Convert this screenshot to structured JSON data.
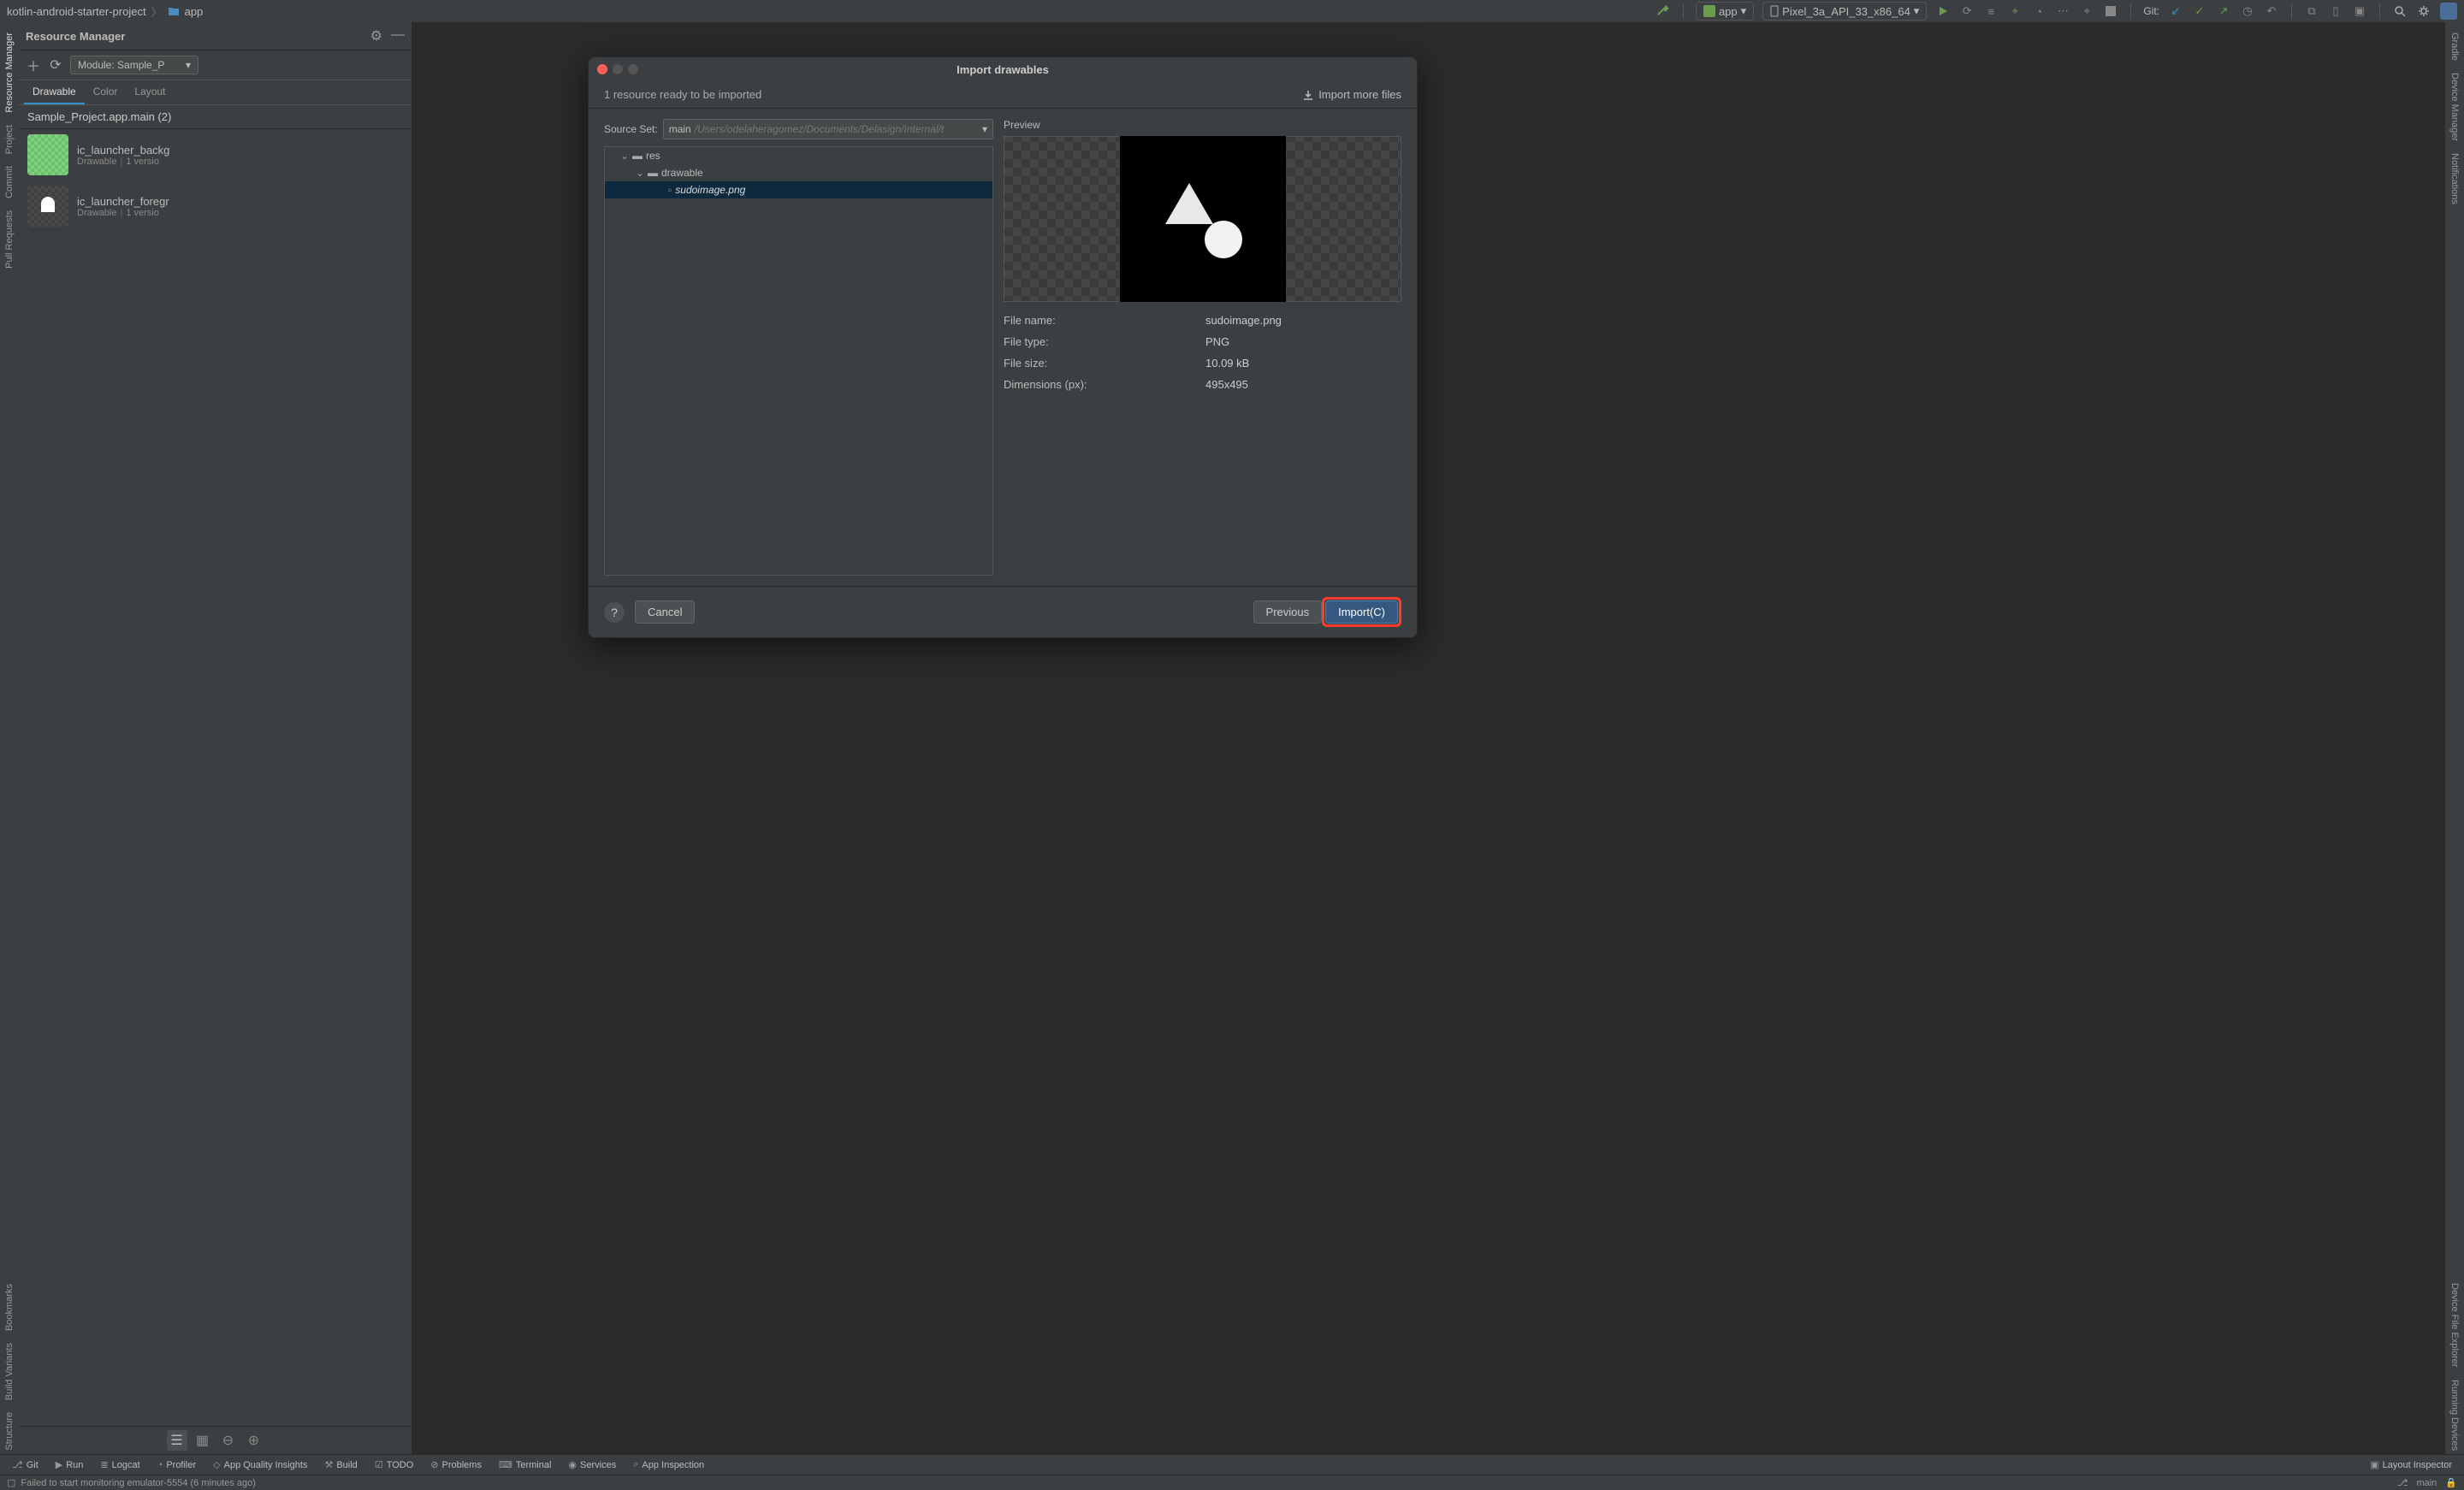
{
  "breadcrumb": {
    "project": "kotlin-android-starter-project",
    "module": "app"
  },
  "toolbar": {
    "run_config_label": "app",
    "device_label": "Pixel_3a_API_33_x86_64",
    "git_label": "Git:"
  },
  "left_strip": {
    "resource_manager": "Resource Manager",
    "project": "Project",
    "commit": "Commit",
    "pull_requests": "Pull Requests",
    "bookmarks": "Bookmarks",
    "build_variants": "Build Variants",
    "structure": "Structure"
  },
  "right_strip": {
    "gradle": "Gradle",
    "device_manager": "Device Manager",
    "notifications": "Notifications",
    "device_file_explorer": "Device File Explorer",
    "running_devices": "Running Devices"
  },
  "resource_panel": {
    "title": "Resource Manager",
    "module_dropdown": "Module: Sample_P",
    "tabs": [
      "Drawable",
      "Color",
      "Layout"
    ],
    "active_tab": 0,
    "module_line": "Sample_Project.app.main (2)",
    "items": [
      {
        "name": "ic_launcher_backg",
        "type": "Drawable",
        "versions": "1 versio"
      },
      {
        "name": "ic_launcher_foregr",
        "type": "Drawable",
        "versions": "1 versio"
      }
    ]
  },
  "dialog": {
    "title": "Import drawables",
    "ready_text": "1 resource ready to be imported",
    "import_more": "Import more files",
    "source_set_label": "Source Set:",
    "source_set_value": "main",
    "source_set_path": "/Users/odelaheragomez/Documents/Delasign/Internal/t",
    "tree": {
      "res": "res",
      "drawable": "drawable",
      "file": "sudoimage.png"
    },
    "preview_label": "Preview",
    "meta": {
      "filename_k": "File name:",
      "filename_v": "sudoimage.png",
      "filetype_k": "File type:",
      "filetype_v": "PNG",
      "filesize_k": "File size:",
      "filesize_v": "10.09 kB",
      "dims_k": "Dimensions (px):",
      "dims_v": "495x495"
    },
    "buttons": {
      "help": "?",
      "cancel": "Cancel",
      "previous": "Previous",
      "import": "Import(C)"
    }
  },
  "bottom_tool": {
    "git": "Git",
    "run": "Run",
    "logcat": "Logcat",
    "profiler": "Profiler",
    "app_quality": "App Quality Insights",
    "build": "Build",
    "todo": "TODO",
    "problems": "Problems",
    "terminal": "Terminal",
    "services": "Services",
    "app_inspection": "App Inspection",
    "layout_inspector": "Layout Inspector"
  },
  "status": {
    "message": "Failed to start monitoring emulator-5554 (6 minutes ago)",
    "branch": "main"
  }
}
